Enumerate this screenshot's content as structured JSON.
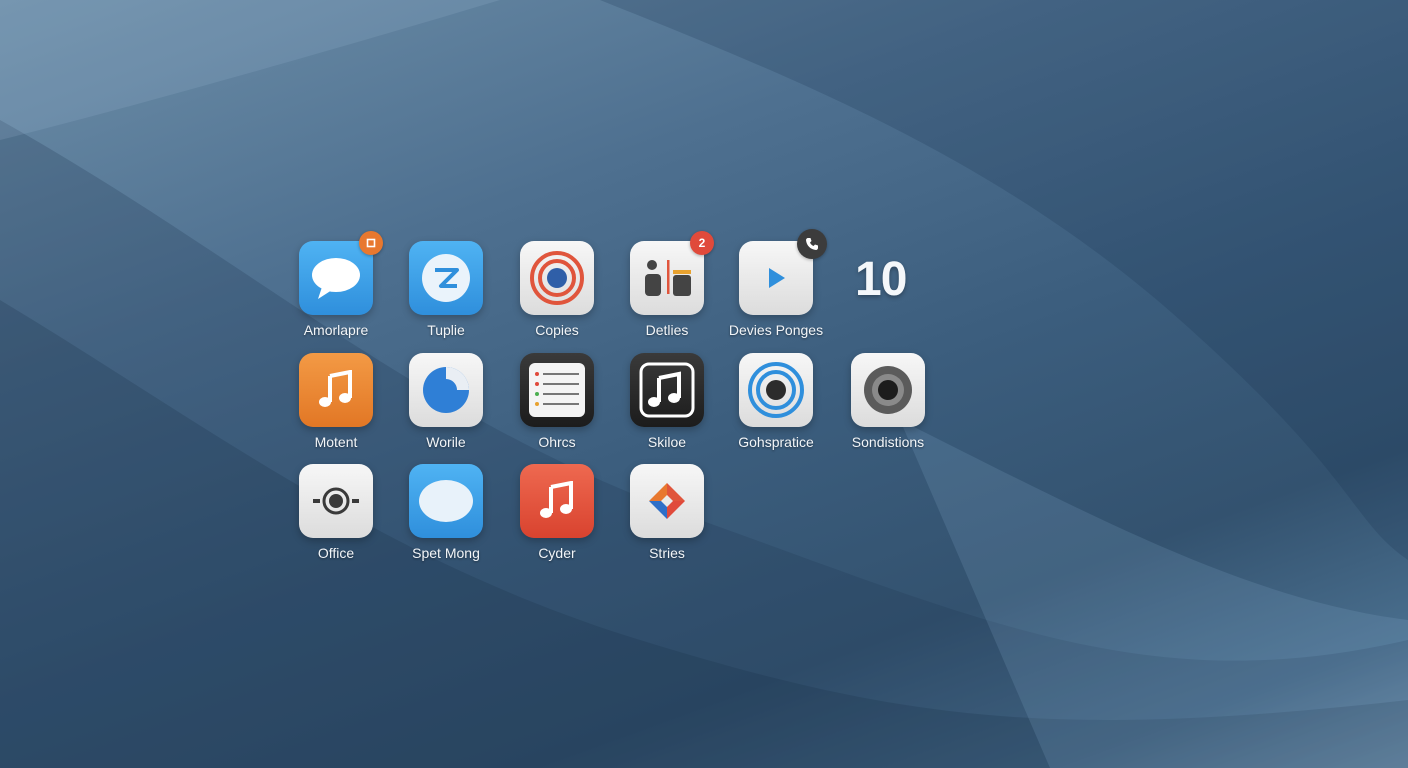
{
  "counter": "10",
  "colors": {
    "badge_orange": "#e8782f",
    "badge_red": "#e04a3b",
    "badge_dark": "#3c3c3c"
  },
  "apps": [
    {
      "label": "Amorlapre",
      "icon": "chat-bubble-icon",
      "badge": ""
    },
    {
      "label": "Tuplie",
      "icon": "compass-icon",
      "badge": ""
    },
    {
      "label": "Copies",
      "icon": "target-rings-icon",
      "badge": ""
    },
    {
      "label": "Detlies",
      "icon": "bars-icon",
      "badge": "2"
    },
    {
      "label": "Devies Ponges",
      "icon": "play-icon",
      "badge": ""
    },
    {
      "label": "Motent",
      "icon": "music-note-icon",
      "badge": ""
    },
    {
      "label": "Worile",
      "icon": "phone-icon",
      "badge": ""
    },
    {
      "label": "Ohrcs",
      "icon": "list-icon",
      "badge": ""
    },
    {
      "label": "Skiloe",
      "icon": "music-note-icon",
      "badge": ""
    },
    {
      "label": "Gohspratice",
      "icon": "radar-icon",
      "badge": ""
    },
    {
      "label": "Sondistions",
      "icon": "camera-lens-icon",
      "badge": ""
    },
    {
      "label": "Office",
      "icon": "camera-icon",
      "badge": ""
    },
    {
      "label": "Spet Mong",
      "icon": "oval-icon",
      "badge": ""
    },
    {
      "label": "Cyder",
      "icon": "music-note-icon",
      "badge": ""
    },
    {
      "label": "Stries",
      "icon": "diamond-logo-icon",
      "badge": ""
    }
  ]
}
